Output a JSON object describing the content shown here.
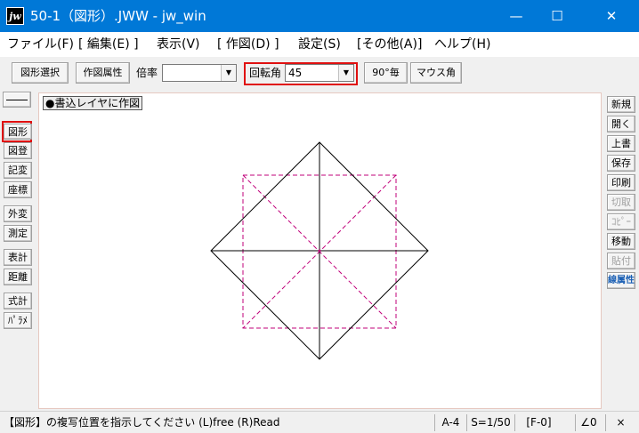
{
  "window": {
    "app_icon": "jw",
    "title": "50-1（図形）.JWW - jw_win",
    "minimize_icon": "—",
    "maximize_icon": "☐",
    "close_icon": "✕"
  },
  "menu": [
    "ファイル(F)",
    "[ 編集(E) ]",
    "表示(V)",
    "[ 作図(D) ]",
    "設定(S)",
    "[その他(A)]",
    "ヘルプ(H)"
  ],
  "toolbar": {
    "shape_select": "図形選択",
    "draw_attr": "作図属性",
    "scale_label": "倍率",
    "scale_value": "",
    "rotation_label": "回転角",
    "rotation_value": "45",
    "deg90": "90°毎",
    "mouse_angle": "マウス角"
  },
  "left_tools": [
    "図形",
    "図登",
    "記変",
    "座標",
    "外変",
    "測定",
    "表計",
    "距離",
    "式計",
    "ﾊﾟﾗﾒ"
  ],
  "right_tools": [
    {
      "label": "新規",
      "state": "normal"
    },
    {
      "label": "開く",
      "state": "normal"
    },
    {
      "label": "上書",
      "state": "normal"
    },
    {
      "label": "保存",
      "state": "normal"
    },
    {
      "label": "印刷",
      "state": "normal"
    },
    {
      "label": "切取",
      "state": "disabled"
    },
    {
      "label": "ｺﾋﾟｰ",
      "state": "disabled"
    },
    {
      "label": "移動",
      "state": "normal"
    },
    {
      "label": "貼付",
      "state": "disabled"
    },
    {
      "label": "線属性",
      "state": "accent"
    }
  ],
  "canvas": {
    "layer_label": "●書込レイヤに作図"
  },
  "colors": {
    "titlebar": "#0078d7",
    "highlight": "#e01010",
    "preview_line": "#c0007a",
    "drawn_line": "#000000"
  },
  "status": {
    "message": "【図形】の複写位置を指示してください (L)free (R)Read",
    "paper": "A-4",
    "scale": "S=1/50",
    "layer": "[F-0]",
    "angle": "∠0",
    "grid": "×"
  }
}
